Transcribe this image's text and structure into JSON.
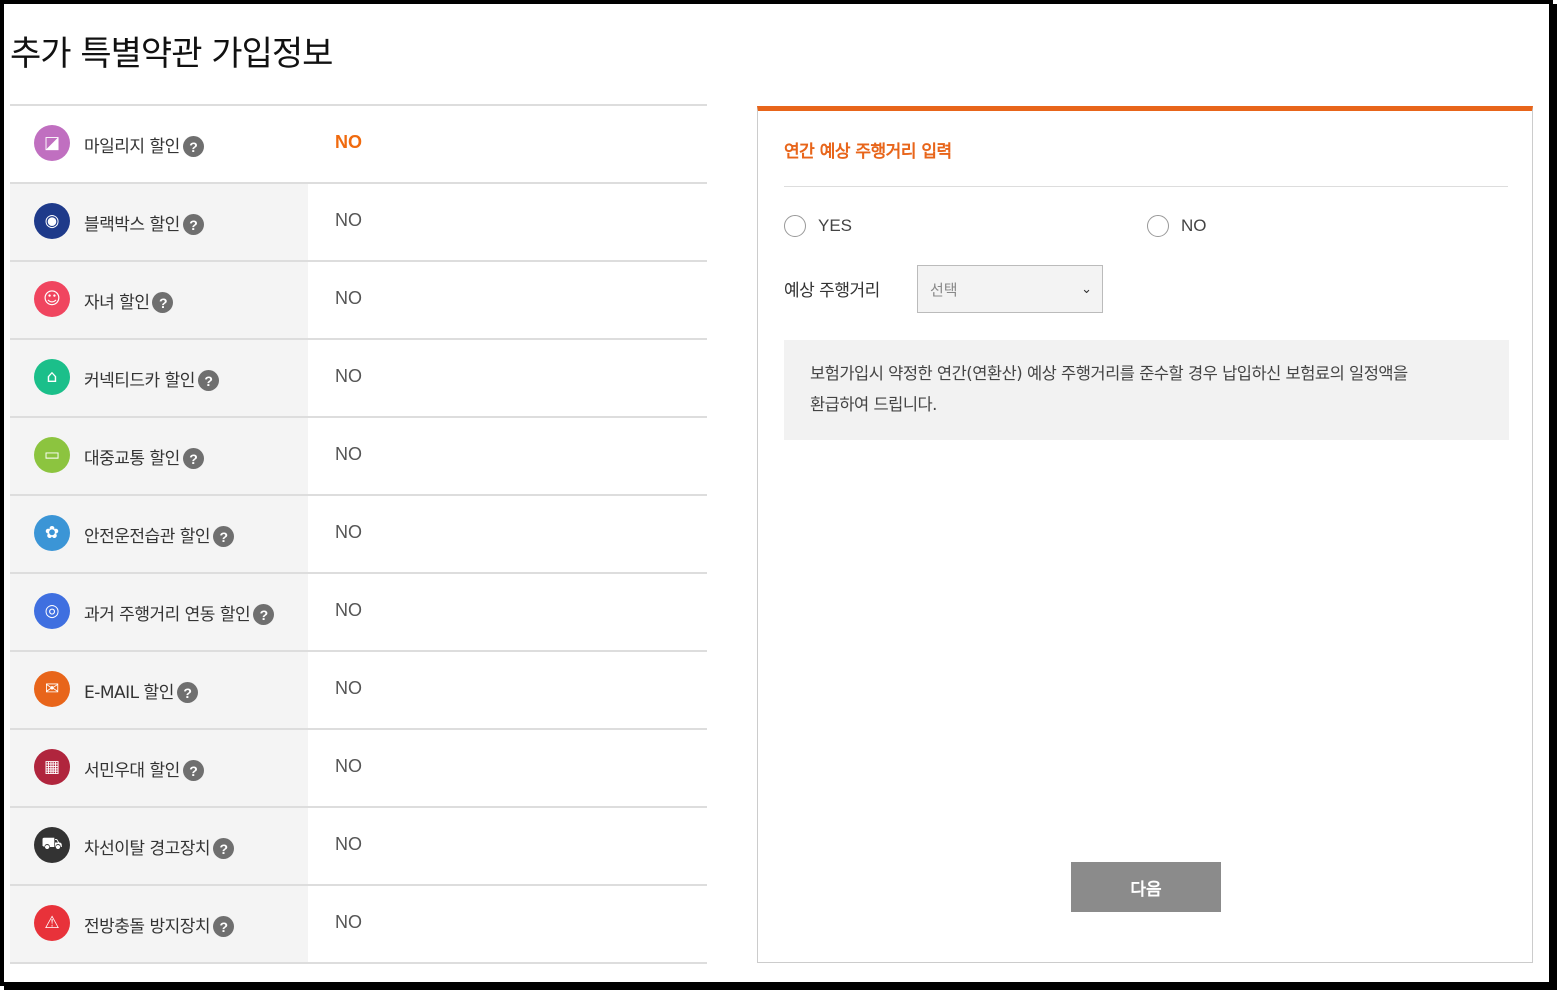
{
  "page": {
    "title": "추가 특별약관 가입정보"
  },
  "discounts": [
    {
      "label": "마일리지 할인",
      "value": "NO",
      "icon": "mileage-icon",
      "icon_glyph": "◪",
      "color": "#c06fc0",
      "highlight": true
    },
    {
      "label": "블랙박스 할인",
      "value": "NO",
      "icon": "blackbox-icon",
      "icon_glyph": "◉",
      "color": "#1e3a8a"
    },
    {
      "label": "자녀 할인",
      "value": "NO",
      "icon": "child-icon",
      "icon_glyph": "☺",
      "color": "#f0455f"
    },
    {
      "label": "커넥티드카 할인",
      "value": "NO",
      "icon": "connected-car-icon",
      "icon_glyph": "⌂",
      "color": "#1bbf8a"
    },
    {
      "label": "대중교통 할인",
      "value": "NO",
      "icon": "bus-icon",
      "icon_glyph": "▭",
      "color": "#8cc43f"
    },
    {
      "label": "안전운전습관 할인",
      "value": "NO",
      "icon": "safe-driving-icon",
      "icon_glyph": "✿",
      "color": "#3b95d6"
    },
    {
      "label": "과거 주행거리 연동 할인",
      "value": "NO",
      "icon": "odometer-icon",
      "icon_glyph": "◎",
      "color": "#3f6fe0"
    },
    {
      "label": "E-MAIL 할인",
      "value": "NO",
      "icon": "email-icon",
      "icon_glyph": "✉",
      "color": "#e8651a"
    },
    {
      "label": "서민우대 할인",
      "value": "NO",
      "icon": "store-icon",
      "icon_glyph": "▦",
      "color": "#b0253d"
    },
    {
      "label": "차선이탈 경고장치",
      "value": "NO",
      "icon": "lane-departure-icon",
      "icon_glyph": "⛟",
      "color": "#333333"
    },
    {
      "label": "전방충돌 방지장치",
      "value": "NO",
      "icon": "collision-icon",
      "icon_glyph": "⚠",
      "color": "#e8323a"
    }
  ],
  "help_glyph": "?",
  "panel": {
    "title": "연간 예상 주행거리 입력",
    "yes_label": "YES",
    "no_label": "NO",
    "distance_label": "예상 주행거리",
    "select_value": "선택",
    "notice_line1": "보험가입시 약정한 연간(연환산) 예상 주행거리를 준수할 경우 납입하신 보험료의 일정액을",
    "notice_line2": "환급하여 드립니다.",
    "next_button": "다음"
  },
  "colors": {
    "accent": "#e8651a",
    "button": "#8b8b8b",
    "row_bg": "#f4f4f4"
  }
}
